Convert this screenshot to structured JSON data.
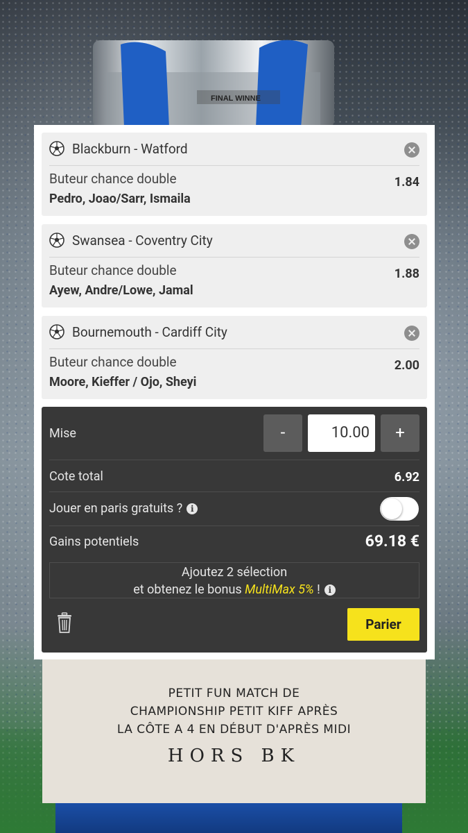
{
  "bets": [
    {
      "match": "Blackburn - Watford",
      "market": "Buteur chance double",
      "pick": "Pedro, Joao/Sarr, Ismaila",
      "odds": "1.84"
    },
    {
      "match": "Swansea - Coventry City",
      "market": "Buteur chance double",
      "pick": "Ayew, Andre/Lowe, Jamal",
      "odds": "1.88"
    },
    {
      "match": "Bournemouth - Cardiff City",
      "market": "Buteur chance double",
      "pick": "Moore, Kieffer / Ojo, Sheyi",
      "odds": "2.00"
    }
  ],
  "slip": {
    "stake_label": "Mise",
    "minus": "-",
    "plus": "+",
    "stake_value": "10.00",
    "total_odds_label": "Cote total",
    "total_odds": "6.92",
    "free_bet_label": "Jouer en paris gratuits ?",
    "free_bet_enabled": false,
    "potential_label": "Gains potentiels",
    "potential_value": "69.18 €",
    "promo_line1": "Ajoutez 2 sélection",
    "promo_line2_pre": "et obtenez le bonus ",
    "promo_highlight": "MultiMax 5%",
    "promo_line2_post": " !",
    "bet_button": "Parier"
  },
  "note": {
    "line1": "PETIT FUN MATCH DE",
    "line2": "CHAMPIONSHIP PETIT KIFF APRÈS",
    "line3": "LA CÔTE A 4 EN DÉBUT D'APRÈS MIDI",
    "signature": "HORS BK"
  },
  "trophy_text": "FINAL WINNE",
  "colors": {
    "accent": "#f6e21c",
    "slip_bg": "#383838",
    "card_bg": "#efefef",
    "note_bg": "#e6e1d9"
  }
}
